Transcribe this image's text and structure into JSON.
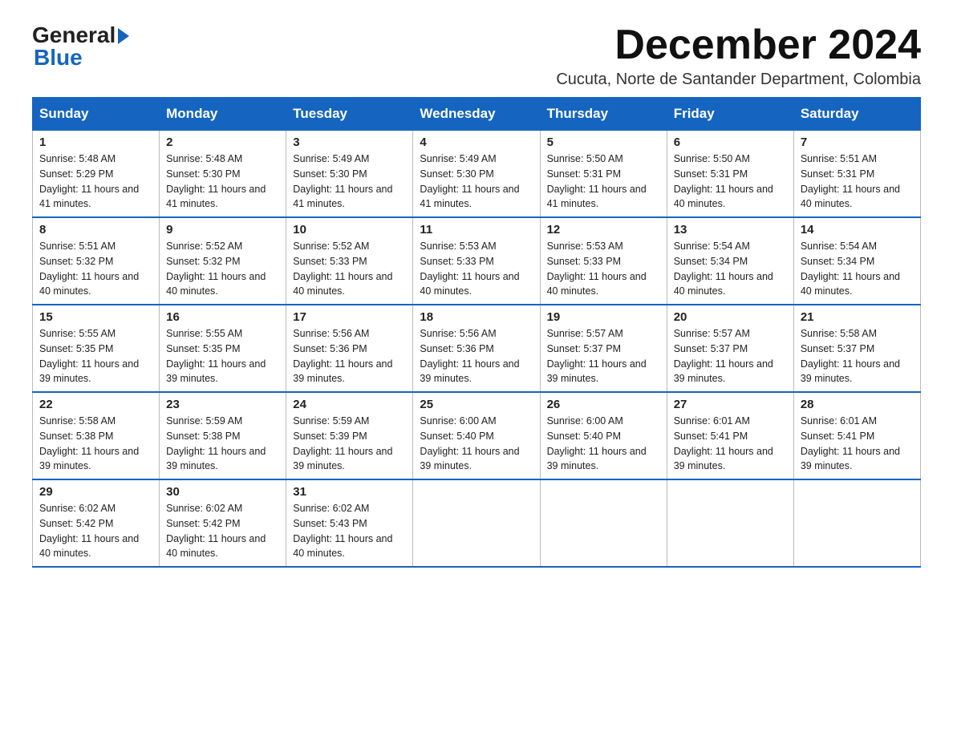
{
  "logo": {
    "general": "General",
    "blue": "Blue"
  },
  "header": {
    "month": "December 2024",
    "location": "Cucuta, Norte de Santander Department, Colombia"
  },
  "days_of_week": [
    "Sunday",
    "Monday",
    "Tuesday",
    "Wednesday",
    "Thursday",
    "Friday",
    "Saturday"
  ],
  "weeks": [
    [
      {
        "day": "1",
        "sunrise": "5:48 AM",
        "sunset": "5:29 PM",
        "daylight": "11 hours and 41 minutes."
      },
      {
        "day": "2",
        "sunrise": "5:48 AM",
        "sunset": "5:30 PM",
        "daylight": "11 hours and 41 minutes."
      },
      {
        "day": "3",
        "sunrise": "5:49 AM",
        "sunset": "5:30 PM",
        "daylight": "11 hours and 41 minutes."
      },
      {
        "day": "4",
        "sunrise": "5:49 AM",
        "sunset": "5:30 PM",
        "daylight": "11 hours and 41 minutes."
      },
      {
        "day": "5",
        "sunrise": "5:50 AM",
        "sunset": "5:31 PM",
        "daylight": "11 hours and 41 minutes."
      },
      {
        "day": "6",
        "sunrise": "5:50 AM",
        "sunset": "5:31 PM",
        "daylight": "11 hours and 40 minutes."
      },
      {
        "day": "7",
        "sunrise": "5:51 AM",
        "sunset": "5:31 PM",
        "daylight": "11 hours and 40 minutes."
      }
    ],
    [
      {
        "day": "8",
        "sunrise": "5:51 AM",
        "sunset": "5:32 PM",
        "daylight": "11 hours and 40 minutes."
      },
      {
        "day": "9",
        "sunrise": "5:52 AM",
        "sunset": "5:32 PM",
        "daylight": "11 hours and 40 minutes."
      },
      {
        "day": "10",
        "sunrise": "5:52 AM",
        "sunset": "5:33 PM",
        "daylight": "11 hours and 40 minutes."
      },
      {
        "day": "11",
        "sunrise": "5:53 AM",
        "sunset": "5:33 PM",
        "daylight": "11 hours and 40 minutes."
      },
      {
        "day": "12",
        "sunrise": "5:53 AM",
        "sunset": "5:33 PM",
        "daylight": "11 hours and 40 minutes."
      },
      {
        "day": "13",
        "sunrise": "5:54 AM",
        "sunset": "5:34 PM",
        "daylight": "11 hours and 40 minutes."
      },
      {
        "day": "14",
        "sunrise": "5:54 AM",
        "sunset": "5:34 PM",
        "daylight": "11 hours and 40 minutes."
      }
    ],
    [
      {
        "day": "15",
        "sunrise": "5:55 AM",
        "sunset": "5:35 PM",
        "daylight": "11 hours and 39 minutes."
      },
      {
        "day": "16",
        "sunrise": "5:55 AM",
        "sunset": "5:35 PM",
        "daylight": "11 hours and 39 minutes."
      },
      {
        "day": "17",
        "sunrise": "5:56 AM",
        "sunset": "5:36 PM",
        "daylight": "11 hours and 39 minutes."
      },
      {
        "day": "18",
        "sunrise": "5:56 AM",
        "sunset": "5:36 PM",
        "daylight": "11 hours and 39 minutes."
      },
      {
        "day": "19",
        "sunrise": "5:57 AM",
        "sunset": "5:37 PM",
        "daylight": "11 hours and 39 minutes."
      },
      {
        "day": "20",
        "sunrise": "5:57 AM",
        "sunset": "5:37 PM",
        "daylight": "11 hours and 39 minutes."
      },
      {
        "day": "21",
        "sunrise": "5:58 AM",
        "sunset": "5:37 PM",
        "daylight": "11 hours and 39 minutes."
      }
    ],
    [
      {
        "day": "22",
        "sunrise": "5:58 AM",
        "sunset": "5:38 PM",
        "daylight": "11 hours and 39 minutes."
      },
      {
        "day": "23",
        "sunrise": "5:59 AM",
        "sunset": "5:38 PM",
        "daylight": "11 hours and 39 minutes."
      },
      {
        "day": "24",
        "sunrise": "5:59 AM",
        "sunset": "5:39 PM",
        "daylight": "11 hours and 39 minutes."
      },
      {
        "day": "25",
        "sunrise": "6:00 AM",
        "sunset": "5:40 PM",
        "daylight": "11 hours and 39 minutes."
      },
      {
        "day": "26",
        "sunrise": "6:00 AM",
        "sunset": "5:40 PM",
        "daylight": "11 hours and 39 minutes."
      },
      {
        "day": "27",
        "sunrise": "6:01 AM",
        "sunset": "5:41 PM",
        "daylight": "11 hours and 39 minutes."
      },
      {
        "day": "28",
        "sunrise": "6:01 AM",
        "sunset": "5:41 PM",
        "daylight": "11 hours and 39 minutes."
      }
    ],
    [
      {
        "day": "29",
        "sunrise": "6:02 AM",
        "sunset": "5:42 PM",
        "daylight": "11 hours and 40 minutes."
      },
      {
        "day": "30",
        "sunrise": "6:02 AM",
        "sunset": "5:42 PM",
        "daylight": "11 hours and 40 minutes."
      },
      {
        "day": "31",
        "sunrise": "6:02 AM",
        "sunset": "5:43 PM",
        "daylight": "11 hours and 40 minutes."
      },
      null,
      null,
      null,
      null
    ]
  ]
}
